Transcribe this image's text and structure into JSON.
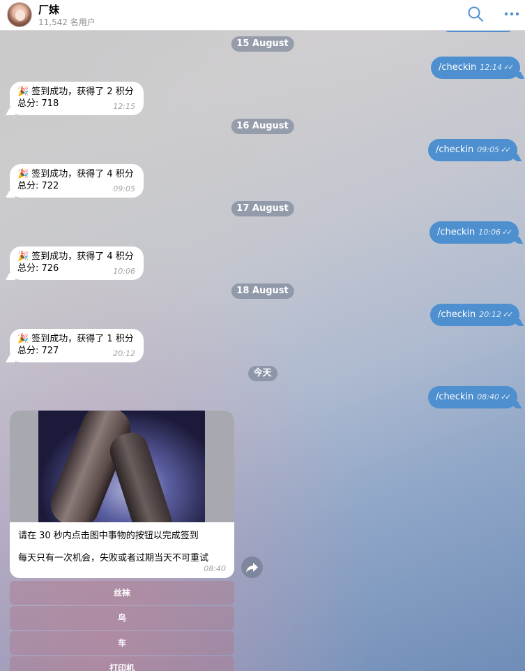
{
  "header": {
    "title": "厂妹",
    "subtitle": "11,542 名用户",
    "search_icon": "search-icon",
    "more_icon": "more-icon",
    "accent_color": "#4d8fcf"
  },
  "dates": [
    "15 August",
    "16 August",
    "17 August",
    "18 August",
    "今天"
  ],
  "outgoing": [
    {
      "text": "/checkin",
      "time": "12:14",
      "status": "✓✓"
    },
    {
      "text": "/checkin",
      "time": "09:05",
      "status": "✓✓"
    },
    {
      "text": "/checkin",
      "time": "10:06",
      "status": "✓✓"
    },
    {
      "text": "/checkin",
      "time": "20:12",
      "status": "✓✓"
    },
    {
      "text": "/checkin",
      "time": "08:40",
      "status": "✓✓"
    }
  ],
  "incoming": [
    {
      "emoji": "🎉",
      "line1": "签到成功，获得了 2 积分",
      "line2": "总分: 718",
      "time": "12:15"
    },
    {
      "emoji": "🎉",
      "line1": "签到成功，获得了 4 积分",
      "line2": "总分: 722",
      "time": "09:05"
    },
    {
      "emoji": "🎉",
      "line1": "签到成功，获得了 4 积分",
      "line2": "总分: 726",
      "time": "10:06"
    },
    {
      "emoji": "🎉",
      "line1": "签到成功，获得了 1 积分",
      "line2": "总分: 727",
      "time": "20:12"
    }
  ],
  "photo_message": {
    "caption_line1": "请在 30 秒内点击图中事物的按钮以完成签到",
    "caption_line2": "每天只有一次机会，失败或者过期当天不可重试",
    "time": "08:40"
  },
  "keyboard": [
    "丝袜",
    "鸟",
    "车",
    "打印机"
  ]
}
